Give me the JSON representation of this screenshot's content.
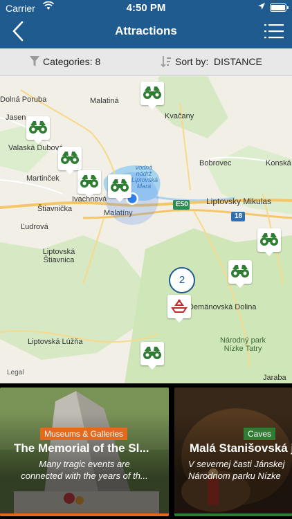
{
  "status": {
    "carrier": "Carrier",
    "time": "4:50 PM"
  },
  "nav": {
    "title": "Attractions"
  },
  "filters": {
    "categories_label": "Categories: 8",
    "sort_label": "Sort by:",
    "sort_value": "DISTANCE"
  },
  "map": {
    "places": [
      "Malatiná",
      "Dolná Poruba",
      "Kvačany",
      "Jasen",
      "Valaská Dubová",
      "Bobrovec",
      "Konská",
      "Martinček",
      "Ivachnová",
      "Liptovsky Mikulas",
      "Štiavnička",
      "Ľudrová",
      "Malatíny",
      "Liptovská Štiavnica",
      "Liptovská Lúžňa",
      "Demänovská Dolina",
      "Národný park Nízke Tatry",
      "Jaraba",
      "vodná nádrž Liptovská Mara"
    ],
    "roads": [
      "E50",
      "18"
    ],
    "cluster_count": "2",
    "legal": "Legal",
    "colors": {
      "water": "#a9d4ee",
      "forest": "#cfe6b8",
      "land": "#f2efe6",
      "road": "#f4c66a",
      "marker": "#2e7d32",
      "cluster": "#1f5b8f"
    }
  },
  "cards": [
    {
      "category": "Museums & Galleries",
      "category_color": "#e3691d",
      "title": "The Memorial of the Sl...",
      "desc_line1": "Many tragic events are",
      "desc_line2": "connected with the years of th..."
    },
    {
      "category": "Caves",
      "category_color": "#2e7d32",
      "title": "Malá Stanišovská j",
      "desc_line1": "V severnej časti Jánskej",
      "desc_line2": "Národnom parku Nízke"
    }
  ]
}
